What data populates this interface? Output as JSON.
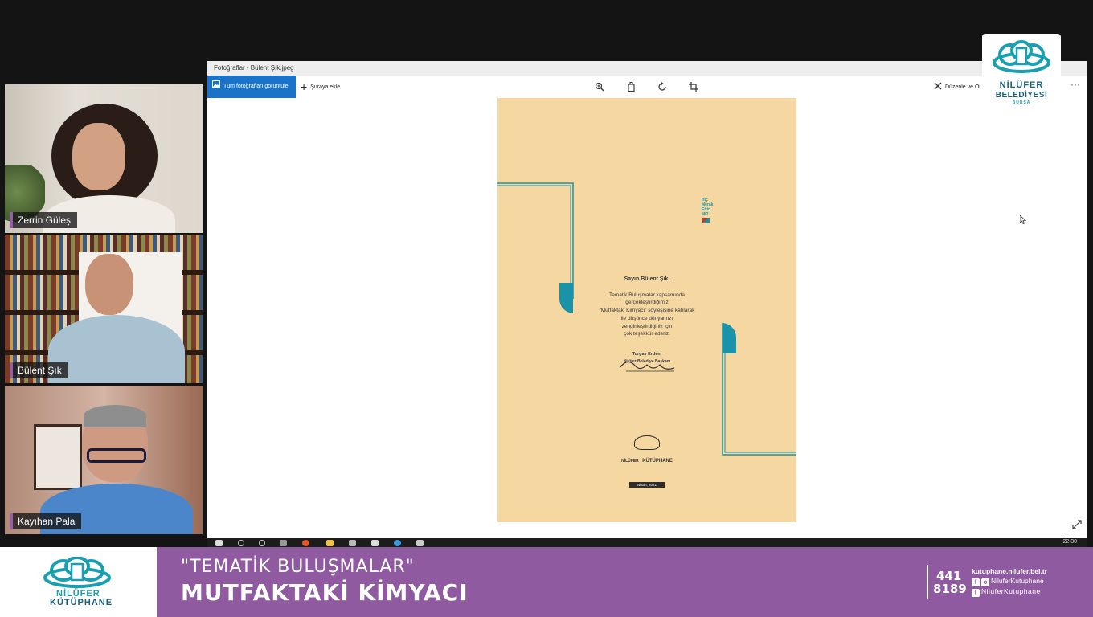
{
  "participants": [
    {
      "name": "Zerrin Güleş"
    },
    {
      "name": "Bülent Şık"
    },
    {
      "name": "Kayıhan Pala"
    }
  ],
  "viewer": {
    "title": "Fotoğraflar - Bülent Şık.jpeg",
    "all_photos_label": "Tüm fotoğrafları görüntüle",
    "add_label": "Şuraya ekle",
    "edit_label": "Düzenle ve Ol",
    "more_label": "···"
  },
  "certificate": {
    "greeting": "Sayın Bülent Şık,",
    "body_lines": [
      "Tematik Buluşmalar kapsamında",
      "gerçekleştirdiğimiz",
      "“Mutfaktaki Kimyacı” söyleşisine katılarak",
      "ile düşünce dünyamızı",
      "zenginleştirdiğiniz için",
      "çok teşekkür ederiz."
    ],
    "signer": "Turgay Erdem",
    "signer_title": "Nilüfer Belediye Başkanı",
    "badge_lines": [
      "Hiç",
      "Merak",
      "Ettin",
      "Mi?"
    ],
    "logo_line1": "NİLÜFER",
    "logo_line2": "KÜTÜPHANE",
    "date": "Nisan, 2021"
  },
  "taskbar": {
    "clock": "22:30"
  },
  "corner_logo": {
    "line1": "NİLÜFER",
    "line2": "BELEDİYESİ",
    "line3": "BURSA"
  },
  "lower_third": {
    "logo_line1": "NİLÜFER",
    "logo_line2": "KÜTÜPHANE",
    "subtitle": "\"TEMATİK BULUŞMALAR\"",
    "title": "MUTFAKTAKİ KİMYACI",
    "phone_line1": "441",
    "phone_line2": "8189",
    "website": "kutuphane.nilufer.bel.tr",
    "social1": "NiluferKutuphane",
    "social2": "NiluferKutuphane"
  },
  "colors": {
    "purple": "#8f5aa0",
    "teal": "#1a93a8",
    "cert_bg": "#f5d7a2",
    "accent_blue": "#1a73c9"
  }
}
